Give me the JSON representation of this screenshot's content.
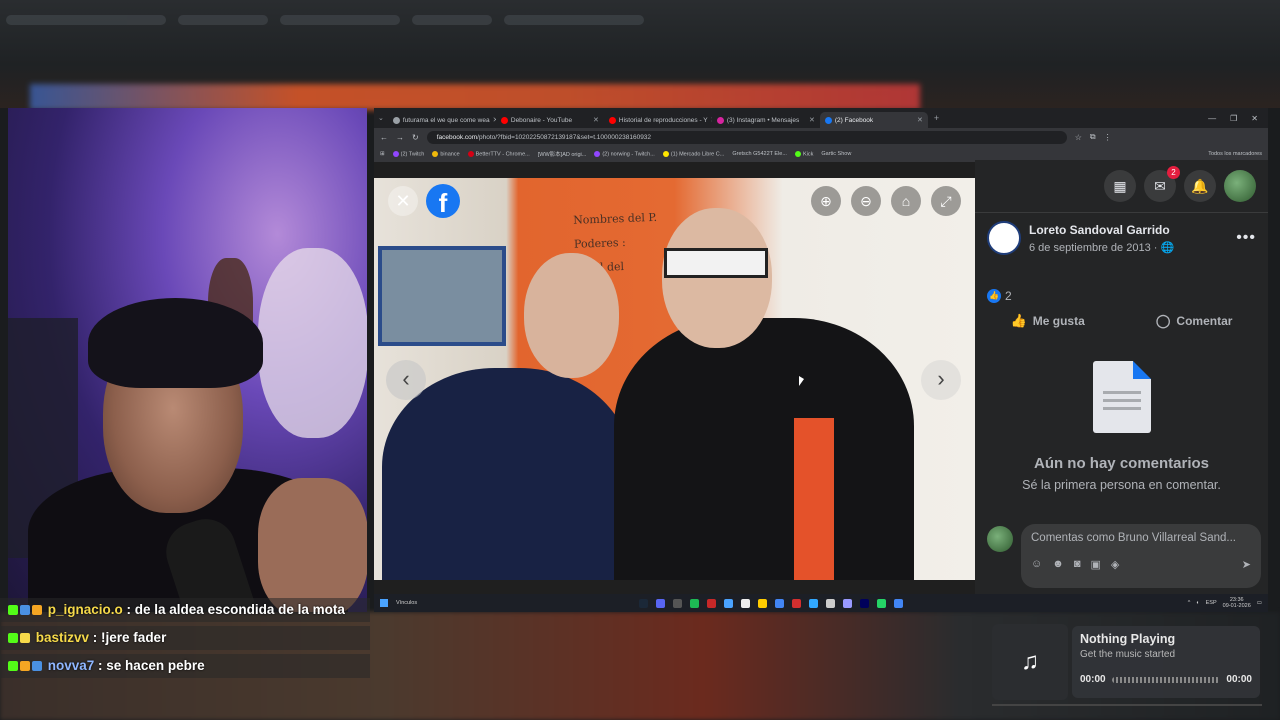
{
  "browser": {
    "tabs": [
      {
        "label": "futurama el we que come wea",
        "color": "#9aa0a6"
      },
      {
        "label": "Debonaire - YouTube",
        "color": "#ff0000"
      },
      {
        "label": "Historial de reproducciones - Y",
        "color": "#ff0000"
      },
      {
        "label": "(3) Instagram • Mensajes",
        "color": "#d6249f"
      },
      {
        "label": "(2) Facebook",
        "color": "#1877f2"
      }
    ],
    "url_prefix": "facebook.com",
    "url_rest": "/photo/?fbid=10202250872139187&set=t.100000238160932",
    "bookmarks": [
      "(2) Twitch",
      "binance",
      "BetterTTV - Chrome...",
      "[WW影本]AD origi...",
      "(2) norwing - Twitch...",
      "(1) Mercado Libre C...",
      "Gretsch G5422T Ele...",
      "Kick",
      "Gartic Show",
      "Todos los marcadores"
    ]
  },
  "viewer": {
    "logo": "f",
    "poster_lines": [
      "Nombres del P.",
      "Poderes :",
      "Edad del"
    ]
  },
  "sidebar": {
    "messenger_badge": "2",
    "post_author": "Loreto Sandoval Garrido",
    "post_date": "6 de septiembre de 2013 · 🌐",
    "like_count": "2",
    "like_label": "Me gusta",
    "comment_label": "Comentar",
    "empty_title": "Aún no hay comentarios",
    "empty_subtitle": "Sé la primera persona en comentar.",
    "composer_placeholder": "Comentas como Bruno Villarreal Sand..."
  },
  "taskbar": {
    "search_label": "Vínculos",
    "lang": "ESP",
    "time": "23:36",
    "date": "09-01-2026"
  },
  "chat": {
    "messages": [
      {
        "user": "p_ignacio.o",
        "text": " : de la aldea escondida de la mota"
      },
      {
        "user": "bastizvv",
        "text": " : !jere fader"
      },
      {
        "user": "novva7",
        "text": " : se hacen pebre"
      }
    ]
  },
  "music": {
    "title": "Nothing Playing",
    "subtitle": "Get the music started",
    "time_start": "00:00",
    "time_end": "00:00"
  }
}
